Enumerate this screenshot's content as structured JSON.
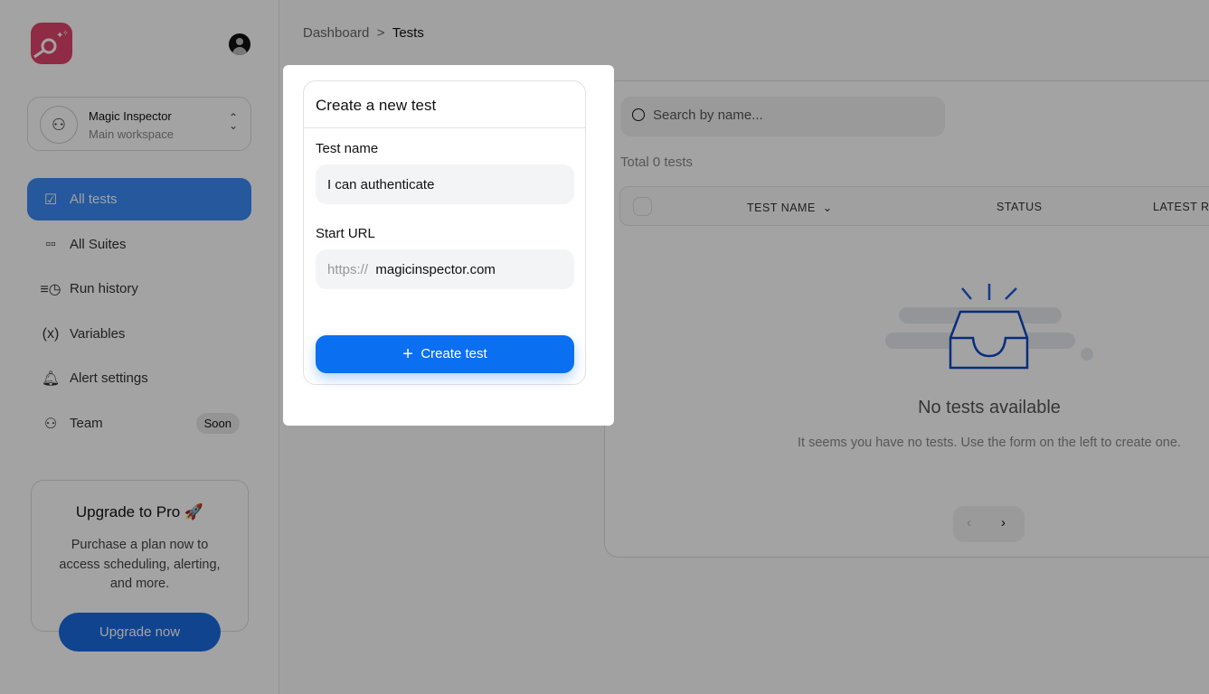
{
  "sidebar": {
    "workspace": {
      "name": "Magic Inspector",
      "sub": "Main workspace"
    },
    "items": [
      {
        "label": "All tests",
        "icon": "checklist-icon"
      },
      {
        "label": "All Suites",
        "icon": "grid-icon"
      },
      {
        "label": "Run history",
        "icon": "history-icon"
      },
      {
        "label": "Variables",
        "icon": "variable-icon"
      },
      {
        "label": "Alert settings",
        "icon": "bell-icon"
      },
      {
        "label": "Team",
        "icon": "team-icon",
        "badge": "Soon"
      }
    ],
    "promo": {
      "title": "Upgrade to Pro 🚀",
      "text": "Purchase a plan now to access scheduling, alerting, and more.",
      "button": "Upgrade now"
    }
  },
  "breadcrumb": {
    "parent": "Dashboard",
    "sep": ">",
    "current": "Tests"
  },
  "form": {
    "title": "Create a new test",
    "name_label": "Test name",
    "name_value": "I can authenticate",
    "url_label": "Start URL",
    "url_prefix": "https://",
    "url_value": "magicinspector.com",
    "submit": "Create test"
  },
  "list": {
    "search_placeholder": "Search by name...",
    "total": "Total 0 tests",
    "columns": [
      "TEST NAME",
      "STATUS",
      "LATEST RU"
    ],
    "empty_title": "No tests available",
    "empty_text": "It seems you have no tests. Use the form on the left to create one.",
    "prev": "‹",
    "next": "›"
  },
  "colors": {
    "accent": "#0b6ff1",
    "logo": "#e0446b"
  }
}
